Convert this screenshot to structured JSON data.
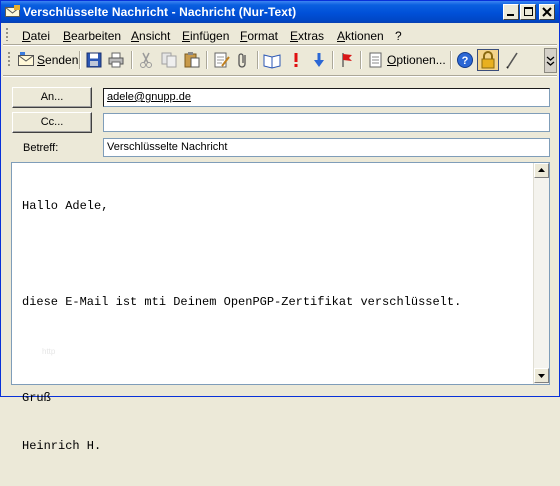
{
  "window": {
    "title": "Verschlüsselte Nachricht - Nachricht (Nur-Text)",
    "controls": [
      "minimize",
      "maximize",
      "close"
    ]
  },
  "menu": {
    "items": [
      "Datei",
      "Bearbeiten",
      "Ansicht",
      "Einfügen",
      "Format",
      "Extras",
      "Aktionen",
      "?"
    ]
  },
  "toolbar": {
    "send_label": "Senden",
    "options_label": "Optionen...",
    "icons": [
      "send-icon",
      "save-icon",
      "print-icon",
      "cut-icon",
      "copy-icon",
      "paste-icon",
      "check-names-icon",
      "attach-icon",
      "address-book-icon",
      "importance-high-icon",
      "importance-low-icon",
      "flag-icon",
      "options-icon",
      "help-icon",
      "encrypt-lock-icon",
      "signature-pen-icon"
    ]
  },
  "compose": {
    "to_button": "An...",
    "cc_button": "Cc...",
    "subject_label": "Betreff:",
    "to_value": "adele@gnupp.de",
    "cc_value": "",
    "subject_value": "Verschlüsselte Nachricht"
  },
  "message": {
    "lines": [
      "Hallo Adele,",
      "",
      "diese E-Mail ist mti Deinem OpenPGP-Zertifikat verschlüsselt.",
      "",
      "Gruß",
      "Heinrich H."
    ],
    "watermark": "http"
  },
  "colors": {
    "titlebar": "#0050d8",
    "window_bg": "#ece9d8",
    "field_border": "#7f9db9",
    "lock_active_bg": "#f3d48c"
  }
}
